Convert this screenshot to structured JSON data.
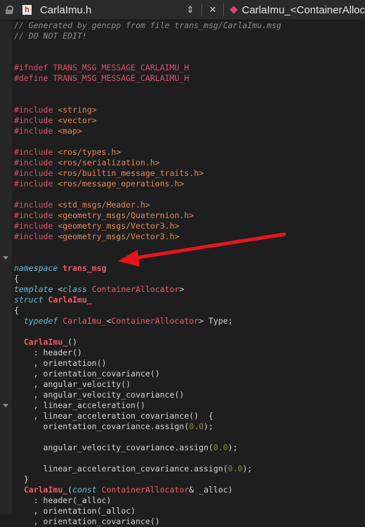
{
  "tabs": {
    "active": "CarlaImu.h",
    "active_icon_letter": "h",
    "other": "CarlaImu_<ContainerAlloc",
    "updown_glyph": "⇕",
    "close_glyph": "✕"
  },
  "code": {
    "c1": "// Generated by gencpp from file trans_msg/CarlaImu.msg",
    "c2": "// DO NOT EDIT!",
    "ifndef": "#ifndef TRANS_MSG_MESSAGE_CARLAIMU_H",
    "define": "#define TRANS_MSG_MESSAGE_CARLAIMU_H",
    "inc1": "<string>",
    "inc2": "<vector>",
    "inc3": "<map>",
    "inc4": "<ros/types.h>",
    "inc5": "<ros/serialization.h>",
    "inc6": "<ros/builtin_message_traits.h>",
    "inc7": "<ros/message_operations.h>",
    "inc8": "<std_msgs/Header.h>",
    "inc9": "<geometry_msgs/Quaternion.h>",
    "inc10": "<geometry_msgs/Vector3.h>",
    "inc11": "<geometry_msgs/Vector3.h>",
    "include_kw": "#include",
    "namespace_kw": "namespace",
    "namespace_name": "trans_msg",
    "template_kw": "template",
    "class_kw": "class",
    "container": "ContainerAllocator",
    "struct_kw": "struct",
    "struct_name": "CarlaImu_",
    "typedef_kw": "typedef",
    "type_word": "Type;",
    "ctor_name": "CarlaImu_",
    "m_header": "header()",
    "m_orientation": "orientation()",
    "m_orientation_cov": "orientation_covariance()",
    "m_ang_vel": "angular_velocity()",
    "m_ang_vel_cov": "angular_velocity_covariance()",
    "m_lin_acc": "linear_acceleration()",
    "m_lin_acc_cov": "linear_acceleration_covariance()",
    "assign1": "orientation_covariance.assign(",
    "assign2": "angular_velocity_covariance.assign(",
    "assign3": "linear_acceleration_covariance.assign(",
    "zero": "0.0",
    "const_kw": "const",
    "alloc_tail": "& _alloc)",
    "a_header": "header(_alloc)",
    "a_orientation": "orientation(_alloc)",
    "a_orientation_cov": "orientation_covariance()"
  },
  "colors": {
    "annotation_arrow": "#e8141b"
  }
}
